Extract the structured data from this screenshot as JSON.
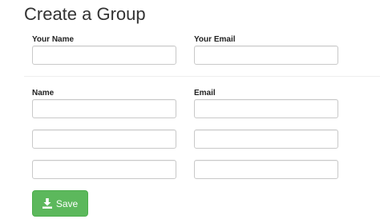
{
  "page": {
    "title": "Create a Group"
  },
  "owner": {
    "name_label": "Your Name",
    "name_value": "",
    "email_label": "Your Email",
    "email_value": ""
  },
  "members": {
    "name_label": "Name",
    "email_label": "Email",
    "rows": [
      {
        "name": "",
        "email": ""
      },
      {
        "name": "",
        "email": ""
      },
      {
        "name": "",
        "email": ""
      }
    ]
  },
  "actions": {
    "save_label": "Save",
    "save_icon": "download-icon",
    "save_color": "#5cb85c"
  }
}
